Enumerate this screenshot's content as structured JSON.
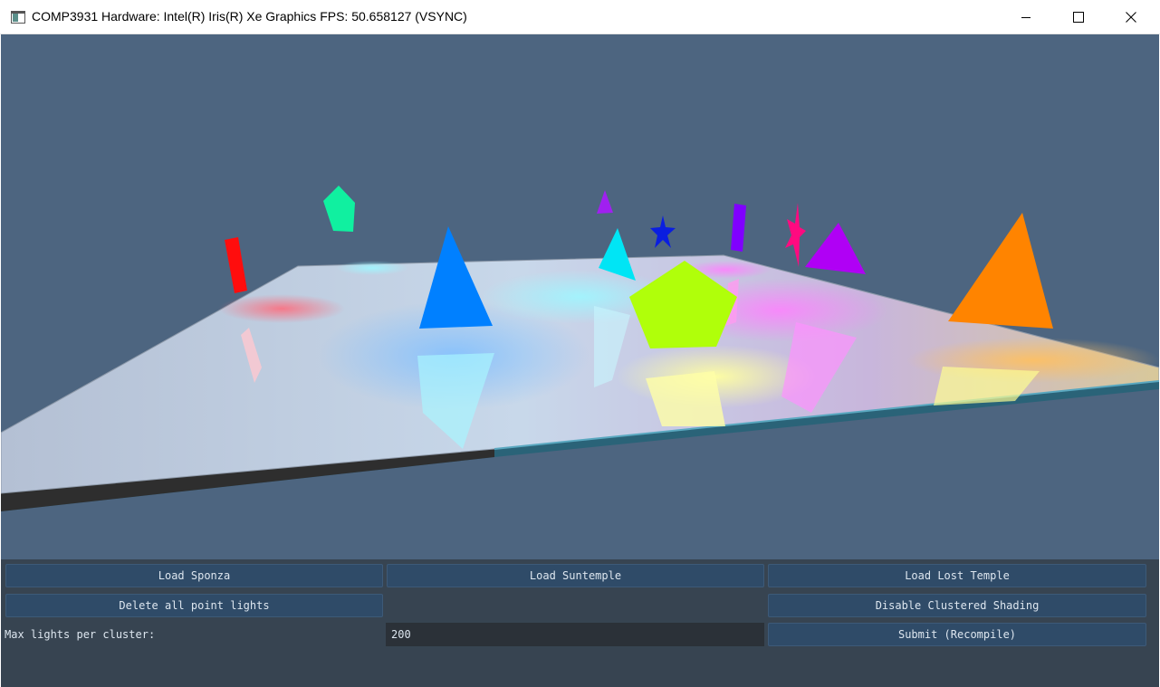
{
  "window": {
    "title": "COMP3931 Hardware: Intel(R) Iris(R) Xe Graphics FPS: 50.658127 (VSYNC)",
    "controls": [
      "minimize-icon",
      "maximize-icon",
      "close-icon"
    ]
  },
  "scene": {
    "background_color": "#4d6580",
    "floor_color": "#a9b8cc",
    "objects": [
      {
        "name": "red-bar",
        "shape": "bar",
        "color": "#ff0d0d"
      },
      {
        "name": "teal-pentagon",
        "shape": "pentagon",
        "color": "#10f0a0"
      },
      {
        "name": "blue-triangle",
        "shape": "triangle",
        "color": "#0080ff"
      },
      {
        "name": "cyan-triangle",
        "shape": "triangle",
        "color": "#00e5f5"
      },
      {
        "name": "purple-small-triangle",
        "shape": "triangle",
        "color": "#a020f0"
      },
      {
        "name": "blue-star",
        "shape": "star",
        "color": "#0a1ee0"
      },
      {
        "name": "purple-bar",
        "shape": "bar",
        "color": "#8000ff"
      },
      {
        "name": "magenta-star",
        "shape": "star",
        "color": "#ff0a80"
      },
      {
        "name": "violet-triangle",
        "shape": "triangle",
        "color": "#b000f5"
      },
      {
        "name": "lime-pentagon",
        "shape": "pentagon",
        "color": "#b0ff0a"
      },
      {
        "name": "orange-triangle",
        "shape": "triangle",
        "color": "#ff8400"
      }
    ]
  },
  "panel": {
    "buttons": {
      "load_sponza": "Load Sponza",
      "load_suntemple": "Load Suntemple",
      "load_lost_temple": "Load Lost Temple",
      "delete_point_lights": "Delete all point lights",
      "disable_clustered": "Disable Clustered Shading",
      "submit": "Submit (Recompile)"
    },
    "max_lights_label": "Max lights per cluster:",
    "max_lights_value": "200"
  }
}
